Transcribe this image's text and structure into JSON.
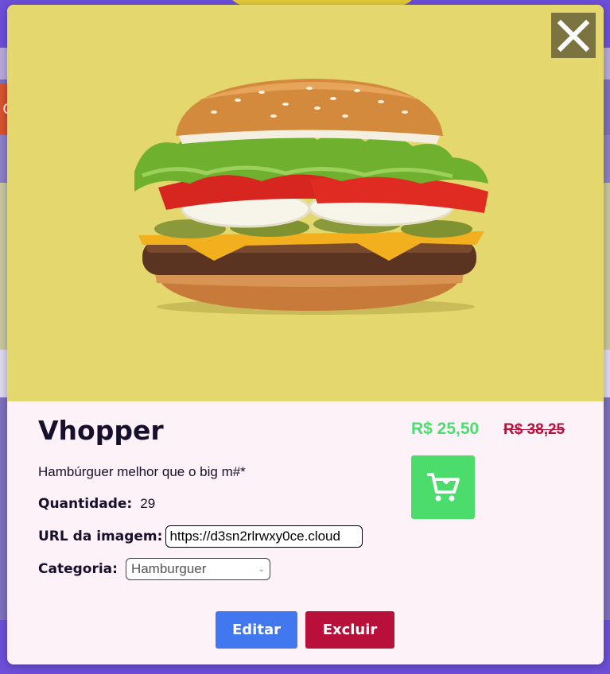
{
  "product": {
    "name": "Vhopper",
    "description": "Hambúrguer melhor que o big m#*",
    "price": "R$ 25,50",
    "old_price": "R$ 38,25",
    "image_icon": "burger-image"
  },
  "fields": {
    "quantity_label": "Quantidade:",
    "quantity_value": "29",
    "url_label": "URL da imagem:",
    "url_value": "https://d3sn2rlrwxy0ce.cloud",
    "category_label": "Categoria:",
    "category_value": "Hamburguer"
  },
  "buttons": {
    "edit": "Editar",
    "delete": "Excluir",
    "close_icon": "close-icon",
    "cart_icon": "cart-add-icon"
  },
  "background": {
    "chip_text": "C"
  },
  "colors": {
    "modal_image_bg": "#e4d76e",
    "price": "#4bdd6f",
    "old_price": "#b3123b",
    "edit_button": "#4278ef",
    "delete_button": "#b8103a",
    "cart_button": "#4cdc6b"
  }
}
